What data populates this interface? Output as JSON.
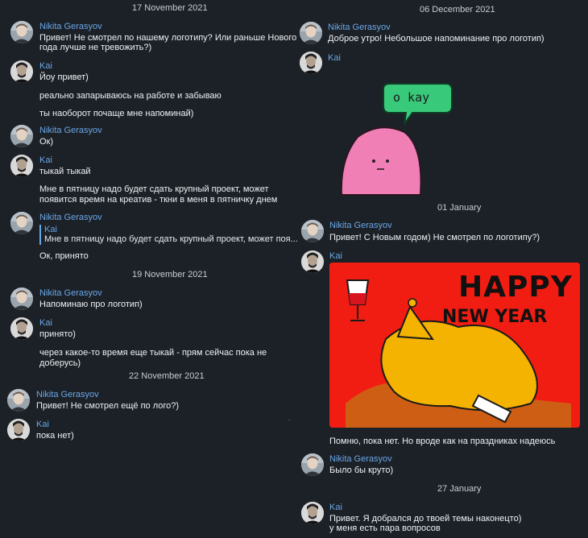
{
  "left": {
    "date1": "17 November 2021",
    "m1": {
      "name": "Nikita Gerasyov",
      "lines": [
        "Привет! Не смотрел по нашему логотипу? Или раньше Нового",
        "года лучше не тревожить?)"
      ]
    },
    "m2": {
      "name": "Kai",
      "lines": [
        "Йоу привет)",
        "реально запарываюсь на работе и забываю",
        "ты наоборот почаще мне напоминай)"
      ]
    },
    "m3": {
      "name": "Nikita Gerasyov",
      "lines": [
        "Ок)"
      ]
    },
    "m4": {
      "name": "Kai",
      "lines": [
        "тыкай тыкай",
        "Мне в пятницу надо будет сдать крупный проект, может",
        "появится время на креатив - ткни в меня в пятничку днем"
      ]
    },
    "m5": {
      "name": "Nikita Gerasyov",
      "quote_name": "Kai",
      "quote_text": "Мне в пятницу надо будет сдать крупный проект, может поя...",
      "lines": [
        "Ок, принято"
      ]
    },
    "date2": "19 November 2021",
    "m6": {
      "name": "Nikita Gerasyov",
      "lines": [
        "Напоминаю про логотип)"
      ]
    },
    "m7": {
      "name": "Kai",
      "lines": [
        "принято)",
        "через какое-то время еще тыкай  - прям сейчас пока не",
        "доберусь)"
      ]
    },
    "date3": "22 November 2021",
    "m8": {
      "name": "Nikita Gerasyov",
      "lines": [
        "Привет! Не смотрел ещё по лого?)"
      ]
    },
    "m9": {
      "name": "Kai",
      "lines": [
        "пока нет)"
      ]
    }
  },
  "right": {
    "date1": "06 December 2021",
    "m1": {
      "name": "Nikita Gerasyov",
      "lines": [
        "Доброе утро! Небольшое напоминание про логотип)"
      ]
    },
    "m2": {
      "name": "Kai",
      "sticker_text": "o kay"
    },
    "date2": "01 January",
    "m3": {
      "name": "Nikita Gerasyov",
      "lines": [
        "Привет! С Новым годом) Не смотрел по логотипу?)"
      ]
    },
    "m4": {
      "name": "Kai",
      "image_text": [
        "HAPPY",
        "NEW YEAR"
      ],
      "lines": [
        "Помню, пока нет. Но вроде как на праздниках надеюсь"
      ]
    },
    "m5": {
      "name": "Nikita Gerasyov",
      "lines": [
        "Было бы круто)"
      ]
    },
    "date3": "27 January",
    "m6": {
      "name": "Kai",
      "lines": [
        "Привет. Я добрался до твоей темы наконецто)",
        "у меня есть пара вопросов"
      ]
    }
  },
  "icons": {
    "avatar_nikita": "avatar-nikita-icon",
    "avatar_kai": "avatar-kai-icon"
  },
  "colors": {
    "background": "#1c2127",
    "name": "#6aa6e6",
    "text": "#eef1f4",
    "sticker_green": "#39c97a",
    "sticker_pink": "#f07fb5",
    "hny_red": "#f21d12"
  }
}
